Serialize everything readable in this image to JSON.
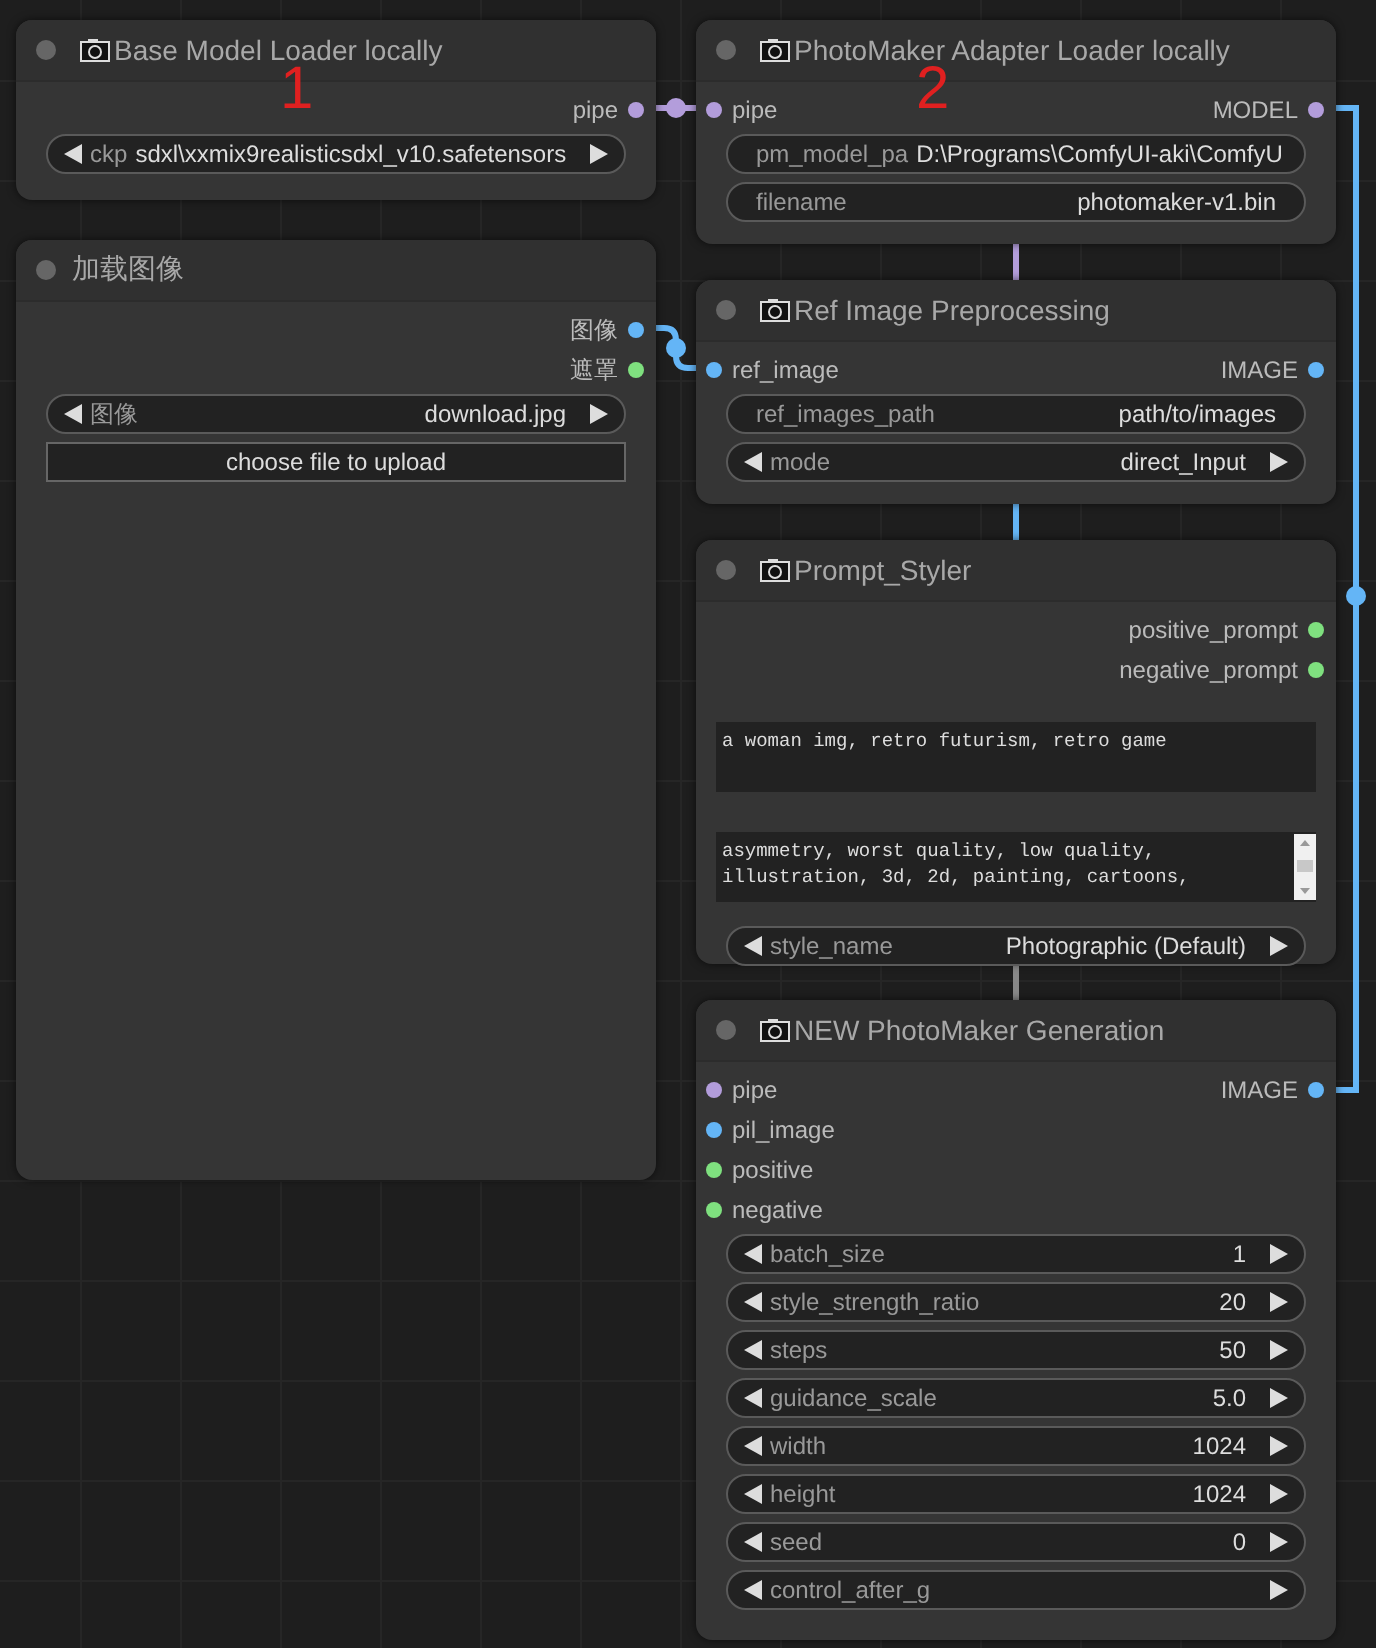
{
  "nodes": [
    {
      "title": "Base Model Loader locally",
      "camera_icon": true,
      "annotation": "1",
      "outputs": [
        {
          "label": "pipe",
          "color": "#b39ddb"
        }
      ],
      "widgets": [
        {
          "kind": "combo",
          "label": "ckp",
          "value": "sdxl\\xxmix9realisticsdxl_v10.safetensors"
        }
      ]
    },
    {
      "title": "加载图像",
      "camera_icon": false,
      "outputs": [
        {
          "label": "图像",
          "color": "#64b5f6"
        },
        {
          "label": "遮罩",
          "color": "#7fe07f"
        }
      ],
      "widgets": [
        {
          "kind": "combo",
          "label": "图像",
          "value": "download.jpg"
        },
        {
          "kind": "button",
          "label": "choose file to upload"
        }
      ]
    },
    {
      "title": "PhotoMaker Adapter Loader locally",
      "camera_icon": true,
      "annotation": "2",
      "inputs": [
        {
          "label": "pipe",
          "color": "#b39ddb"
        }
      ],
      "outputs": [
        {
          "label": "MODEL",
          "color": "#b39ddb"
        }
      ],
      "widgets": [
        {
          "kind": "text",
          "label": "pm_model_pa",
          "value": "D:\\Programs\\ComfyUI-aki\\ComfyU"
        },
        {
          "kind": "text",
          "label": "filename",
          "value": "photomaker-v1.bin"
        }
      ]
    },
    {
      "title": "Ref Image Preprocessing",
      "camera_icon": true,
      "inputs": [
        {
          "label": "ref_image",
          "color": "#64b5f6"
        }
      ],
      "outputs": [
        {
          "label": "IMAGE",
          "color": "#64b5f6"
        }
      ],
      "widgets": [
        {
          "kind": "text",
          "label": "ref_images_path",
          "value": "path/to/images"
        },
        {
          "kind": "combo",
          "label": "mode",
          "value": "direct_Input"
        }
      ]
    },
    {
      "title": "Prompt_Styler",
      "camera_icon": true,
      "outputs": [
        {
          "label": "positive_prompt",
          "color": "#7fe07f"
        },
        {
          "label": "negative_prompt",
          "color": "#7fe07f"
        }
      ],
      "widgets": [
        {
          "kind": "textarea",
          "value": "a woman img, retro futurism, retro game"
        },
        {
          "kind": "textarea",
          "scrollbar": true,
          "value": "asymmetry, worst quality, low quality, illustration, 3d, 2d, painting, cartoons,"
        },
        {
          "kind": "combo",
          "label": "style_name",
          "value": "Photographic (Default)"
        }
      ]
    },
    {
      "title": "NEW PhotoMaker Generation",
      "camera_icon": true,
      "inputs": [
        {
          "label": "pipe",
          "color": "#b39ddb"
        },
        {
          "label": "pil_image",
          "color": "#64b5f6"
        },
        {
          "label": "positive",
          "color": "#7fe07f"
        },
        {
          "label": "negative",
          "color": "#7fe07f"
        }
      ],
      "outputs": [
        {
          "label": "IMAGE",
          "color": "#64b5f6"
        }
      ],
      "widgets": [
        {
          "kind": "combo",
          "label": "batch_size",
          "value": "1"
        },
        {
          "kind": "combo",
          "label": "style_strength_ratio",
          "value": "20"
        },
        {
          "kind": "combo",
          "label": "steps",
          "value": "50"
        },
        {
          "kind": "combo",
          "label": "guidance_scale",
          "value": "5.0"
        },
        {
          "kind": "combo",
          "label": "width",
          "value": "1024"
        },
        {
          "kind": "combo",
          "label": "height",
          "value": "1024"
        },
        {
          "kind": "combo",
          "label": "seed",
          "value": "0"
        },
        {
          "kind": "combo",
          "label": "control_after_g"
        }
      ]
    }
  ]
}
